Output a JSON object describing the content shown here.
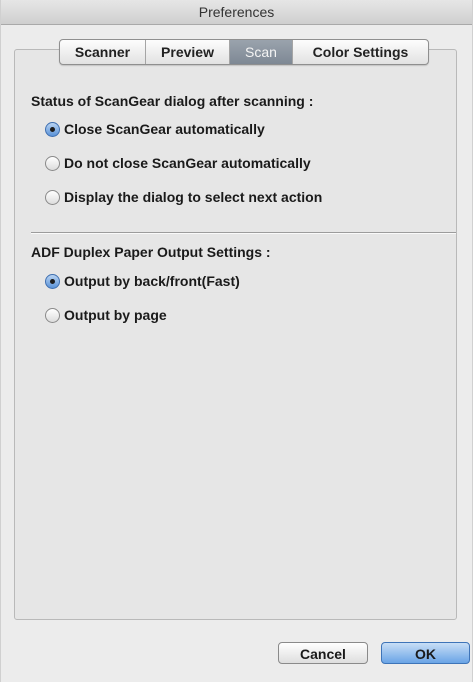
{
  "window": {
    "title": "Preferences"
  },
  "tabs": [
    {
      "label": "Scanner",
      "selected": false
    },
    {
      "label": "Preview",
      "selected": false
    },
    {
      "label": "Scan",
      "selected": true
    },
    {
      "label": "Color Settings",
      "selected": false
    }
  ],
  "scangear_status": {
    "label": "Status of ScanGear dialog after scanning :",
    "options": [
      {
        "label": "Close ScanGear automatically",
        "selected": true
      },
      {
        "label": "Do not close ScanGear automatically",
        "selected": false
      },
      {
        "label": "Display the dialog to select next action",
        "selected": false
      }
    ]
  },
  "adf_duplex": {
    "label": "ADF Duplex Paper Output Settings :",
    "options": [
      {
        "label": "Output by back/front(Fast)",
        "selected": true
      },
      {
        "label": "Output by page",
        "selected": false
      }
    ]
  },
  "buttons": {
    "cancel": "Cancel",
    "ok": "OK"
  },
  "colors": {
    "accent": "#5a93d8",
    "selected_tab": "#858f9b"
  }
}
